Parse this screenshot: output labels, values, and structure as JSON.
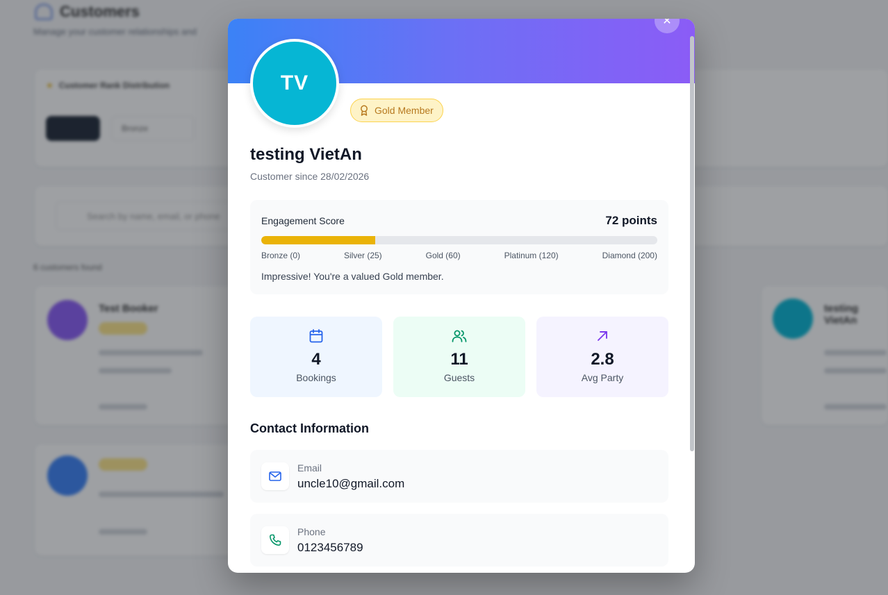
{
  "background": {
    "page_title": "Customers",
    "page_subtitle": "Manage your customer relationships and",
    "rank_distribution_title": "Customer Rank Distribution",
    "filter_bronze": "Bronze",
    "search_placeholder": "Search by name, email, or phone",
    "found_text": "6 customers found",
    "cards": [
      {
        "name": "Test Booker"
      },
      {
        "name": "testing VietAn"
      }
    ]
  },
  "modal": {
    "close_icon": "x-icon",
    "avatar_initials": "TV",
    "rank_badge": "Gold Member",
    "customer_name": "testing VietAn",
    "customer_since": "Customer since 28/02/2026",
    "engagement": {
      "label": "Engagement Score",
      "points_text": "72 points",
      "progress_fraction": 0.288,
      "tiers": [
        "Bronze (0)",
        "Silver (25)",
        "Gold (60)",
        "Platinum (120)",
        "Diamond (200)"
      ],
      "message": "Impressive! You're a valued Gold member."
    },
    "stats": [
      {
        "icon": "calendar-icon",
        "value": "4",
        "label": "Bookings"
      },
      {
        "icon": "users-icon",
        "value": "11",
        "label": "Guests"
      },
      {
        "icon": "trend-arrow-icon",
        "value": "2.8",
        "label": "Avg Party"
      }
    ],
    "contact": {
      "title": "Contact Information",
      "email_label": "Email",
      "email_value": "uncle10@gmail.com",
      "phone_label": "Phone",
      "phone_value": "0123456789"
    }
  },
  "colors": {
    "gold": "#eab308",
    "banner_start": "#3b82f6",
    "banner_end": "#8b5cf6",
    "avatar": "#06b6d4"
  }
}
